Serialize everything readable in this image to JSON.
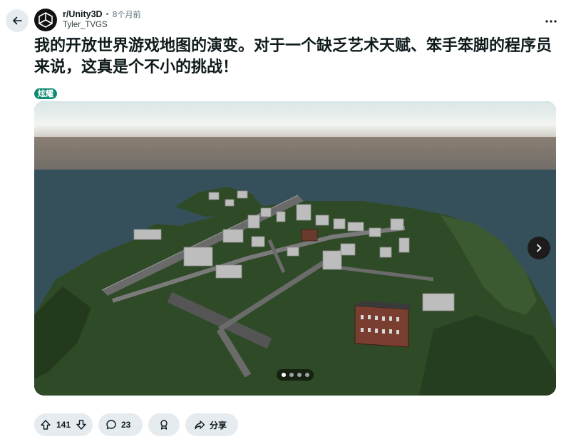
{
  "post": {
    "subreddit": "r/Unity3D",
    "separator": "•",
    "time_ago": "8个月前",
    "author": "Tyler_TVGS",
    "title": "我的开放世界游戏地图的演变。对于一个缺乏艺术天赋、笨手笨脚的程序员来说，这真是个不小的挑战！",
    "flair": "炫耀"
  },
  "gallery": {
    "current_index": 1,
    "total": 4
  },
  "actions": {
    "upvotes": "141",
    "comments": "23",
    "share_label": "分享"
  },
  "icons": {
    "back": "arrow-left-icon",
    "more": "more-horizontal-icon",
    "next": "chevron-right-icon",
    "upvote": "arrow-up-icon",
    "downvote": "arrow-down-icon",
    "comment": "comment-bubble-icon",
    "award": "award-icon",
    "share": "share-icon"
  },
  "colors": {
    "flair_bg": "#0e8a71",
    "pill_bg": "#e5ebee",
    "text": "#0f1a1c"
  }
}
